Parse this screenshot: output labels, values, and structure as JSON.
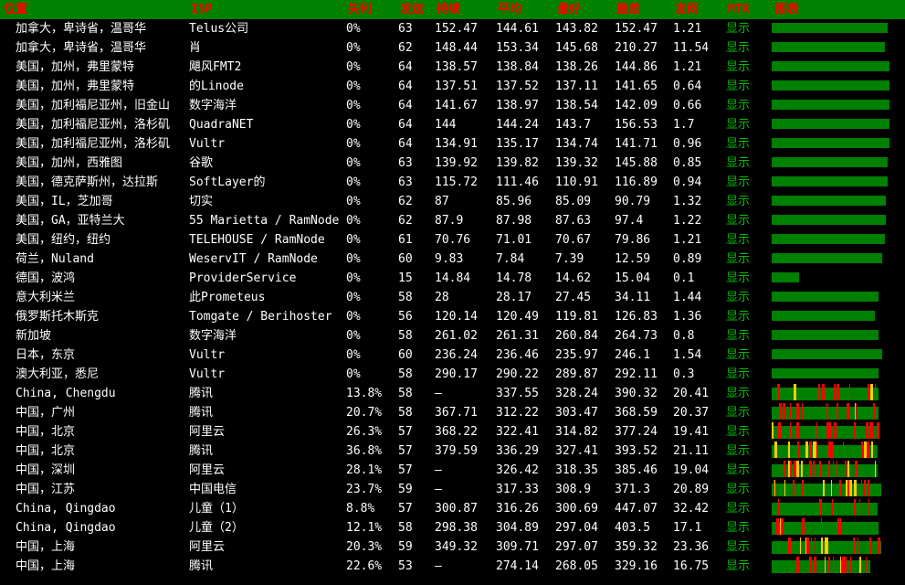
{
  "headers": {
    "location": "位置",
    "isp": "ISP",
    "loss": "失利",
    "sent": "发送",
    "last": "持续",
    "avg": "平均",
    "best": "最好",
    "worst": "最差",
    "stdev": "发网",
    "mtr": "MTR",
    "chart": "图表"
  },
  "mtr_link_label": "显示",
  "colors": {
    "header_bg": "#008000",
    "header_text": "#ff0000",
    "ok": "#008000",
    "warn": "#ffcc00",
    "bad": "#ff0000",
    "link": "#00c000"
  },
  "rows": [
    {
      "location": "加拿大，卑诗省，温哥华",
      "isp": "Telus公司",
      "loss": "0%",
      "sent": "63",
      "last": "152.47",
      "avg": "144.61",
      "best": "143.82",
      "worst": "152.47",
      "stdev": "1.21",
      "fill": 0.98
    },
    {
      "location": "加拿大，卑诗省，温哥华",
      "isp": "肖",
      "loss": "0%",
      "sent": "62",
      "last": "148.44",
      "avg": "153.34",
      "best": "145.68",
      "worst": "210.27",
      "stdev": "11.54",
      "fill": 0.95
    },
    {
      "location": "美国，加州，弗里蒙特",
      "isp": "飓风FMT2",
      "loss": "0%",
      "sent": "64",
      "last": "138.57",
      "avg": "138.84",
      "best": "138.26",
      "worst": "144.86",
      "stdev": "1.21",
      "fill": 0.99
    },
    {
      "location": "美国，加州，弗里蒙特",
      "isp": "的Linode",
      "loss": "0%",
      "sent": "64",
      "last": "137.51",
      "avg": "137.52",
      "best": "137.11",
      "worst": "141.65",
      "stdev": "0.64",
      "fill": 0.99
    },
    {
      "location": "美国，加利福尼亚州，旧金山",
      "isp": "数字海洋",
      "loss": "0%",
      "sent": "64",
      "last": "141.67",
      "avg": "138.97",
      "best": "138.54",
      "worst": "142.09",
      "stdev": "0.66",
      "fill": 0.99
    },
    {
      "location": "美国，加利福尼亚州，洛杉矶",
      "isp": "QuadraNET",
      "loss": "0%",
      "sent": "64",
      "last": "144",
      "avg": "144.24",
      "best": "143.7",
      "worst": "156.53",
      "stdev": "1.7",
      "fill": 0.99
    },
    {
      "location": "美国，加利福尼亚州，洛杉矶",
      "isp": "Vultr",
      "loss": "0%",
      "sent": "64",
      "last": "134.91",
      "avg": "135.17",
      "best": "134.74",
      "worst": "141.71",
      "stdev": "0.96",
      "fill": 0.99
    },
    {
      "location": "美国，加州，西雅图",
      "isp": "谷歌",
      "loss": "0%",
      "sent": "63",
      "last": "139.92",
      "avg": "139.82",
      "best": "139.32",
      "worst": "145.88",
      "stdev": "0.85",
      "fill": 0.98
    },
    {
      "location": "美国，德克萨斯州，达拉斯",
      "isp": "SoftLayer的",
      "loss": "0%",
      "sent": "63",
      "last": "115.72",
      "avg": "111.46",
      "best": "110.91",
      "worst": "116.89",
      "stdev": "0.94",
      "fill": 0.98
    },
    {
      "location": "美国，IL，芝加哥",
      "isp": "切实",
      "loss": "0%",
      "sent": "62",
      "last": "87",
      "avg": "85.96",
      "best": "85.09",
      "worst": "90.79",
      "stdev": "1.32",
      "fill": 0.96
    },
    {
      "location": "美国，GA，亚特兰大",
      "isp": "55 Marietta / RamNode",
      "loss": "0%",
      "sent": "62",
      "last": "87.9",
      "avg": "87.98",
      "best": "87.63",
      "worst": "97.4",
      "stdev": "1.22",
      "fill": 0.96
    },
    {
      "location": "美国，纽约，纽约",
      "isp": "TELEHOUSE / RamNode",
      "loss": "0%",
      "sent": "61",
      "last": "70.76",
      "avg": "71.01",
      "best": "70.67",
      "worst": "79.86",
      "stdev": "1.21",
      "fill": 0.95
    },
    {
      "location": "荷兰，Nuland",
      "isp": "WeservIT / RamNode",
      "loss": "0%",
      "sent": "60",
      "last": "9.83",
      "avg": "7.84",
      "best": "7.39",
      "worst": "12.59",
      "stdev": "0.89",
      "fill": 0.93
    },
    {
      "location": "德国，波鸿",
      "isp": "ProviderService",
      "loss": "0%",
      "sent": "15",
      "last": "14.84",
      "avg": "14.78",
      "best": "14.62",
      "worst": "15.04",
      "stdev": "0.1",
      "fill": 0.23
    },
    {
      "location": "意大利米兰",
      "isp": "此Prometeus",
      "loss": "0%",
      "sent": "58",
      "last": "28",
      "avg": "28.17",
      "best": "27.45",
      "worst": "34.11",
      "stdev": "1.44",
      "fill": 0.9
    },
    {
      "location": "俄罗斯托木斯克",
      "isp": "Tomgate / Berihoster",
      "loss": "0%",
      "sent": "56",
      "last": "120.14",
      "avg": "120.49",
      "best": "119.81",
      "worst": "126.83",
      "stdev": "1.36",
      "fill": 0.87
    },
    {
      "location": "新加坡",
      "isp": "数字海洋",
      "loss": "0%",
      "sent": "58",
      "last": "261.02",
      "avg": "261.31",
      "best": "260.84",
      "worst": "264.73",
      "stdev": "0.8",
      "fill": 0.9
    },
    {
      "location": "日本，东京",
      "isp": "Vultr",
      "loss": "0%",
      "sent": "60",
      "last": "236.24",
      "avg": "236.46",
      "best": "235.97",
      "worst": "246.1",
      "stdev": "1.54",
      "fill": 0.93
    },
    {
      "location": "澳大利亚，悉尼",
      "isp": "Vultr",
      "loss": "0%",
      "sent": "58",
      "last": "290.17",
      "avg": "290.22",
      "best": "289.87",
      "worst": "292.11",
      "stdev": "0.3",
      "fill": 0.9
    },
    {
      "location": "China, Chengdu",
      "isp": "腾讯",
      "loss": "13.8%",
      "sent": "58",
      "last": "–",
      "avg": "337.55",
      "best": "328.24",
      "worst": "390.32",
      "stdev": "20.41",
      "fill": 0.9
    },
    {
      "location": "中国，广州",
      "isp": "腾讯",
      "loss": "20.7%",
      "sent": "58",
      "last": "367.71",
      "avg": "312.22",
      "best": "303.47",
      "worst": "368.59",
      "stdev": "20.37",
      "fill": 0.9
    },
    {
      "location": "中国，北京",
      "isp": "阿里云",
      "loss": "26.3%",
      "sent": "57",
      "last": "368.22",
      "avg": "322.41",
      "best": "314.82",
      "worst": "377.24",
      "stdev": "19.41",
      "fill": 0.89
    },
    {
      "location": "中国，北京",
      "isp": "腾讯",
      "loss": "36.8%",
      "sent": "57",
      "last": "379.59",
      "avg": "336.29",
      "best": "327.41",
      "worst": "393.52",
      "stdev": "21.11",
      "fill": 0.89
    },
    {
      "location": "中国，深圳",
      "isp": "阿里云",
      "loss": "28.1%",
      "sent": "57",
      "last": "–",
      "avg": "326.42",
      "best": "318.35",
      "worst": "385.46",
      "stdev": "19.04",
      "fill": 0.89
    },
    {
      "location": "中国，江苏",
      "isp": "中国电信",
      "loss": "23.7%",
      "sent": "59",
      "last": "–",
      "avg": "317.33",
      "best": "308.9",
      "worst": "371.3",
      "stdev": "20.89",
      "fill": 0.92
    },
    {
      "location": "China, Qingdao",
      "isp": "儿童（1）",
      "loss": "8.8%",
      "sent": "57",
      "last": "300.87",
      "avg": "316.26",
      "best": "300.69",
      "worst": "447.07",
      "stdev": "32.42",
      "fill": 0.89
    },
    {
      "location": "China, Qingdao",
      "isp": "儿童（2）",
      "loss": "12.1%",
      "sent": "58",
      "last": "298.38",
      "avg": "304.89",
      "best": "297.04",
      "worst": "403.5",
      "stdev": "17.1",
      "fill": 0.9
    },
    {
      "location": "中国，上海",
      "isp": "阿里云",
      "loss": "20.3%",
      "sent": "59",
      "last": "349.32",
      "avg": "309.71",
      "best": "297.07",
      "worst": "359.32",
      "stdev": "23.36",
      "fill": 0.92
    },
    {
      "location": "中国，上海",
      "isp": "腾讯",
      "loss": "22.6%",
      "sent": "53",
      "last": "–",
      "avg": "274.14",
      "best": "268.05",
      "worst": "329.16",
      "stdev": "16.75",
      "fill": 0.83
    }
  ]
}
